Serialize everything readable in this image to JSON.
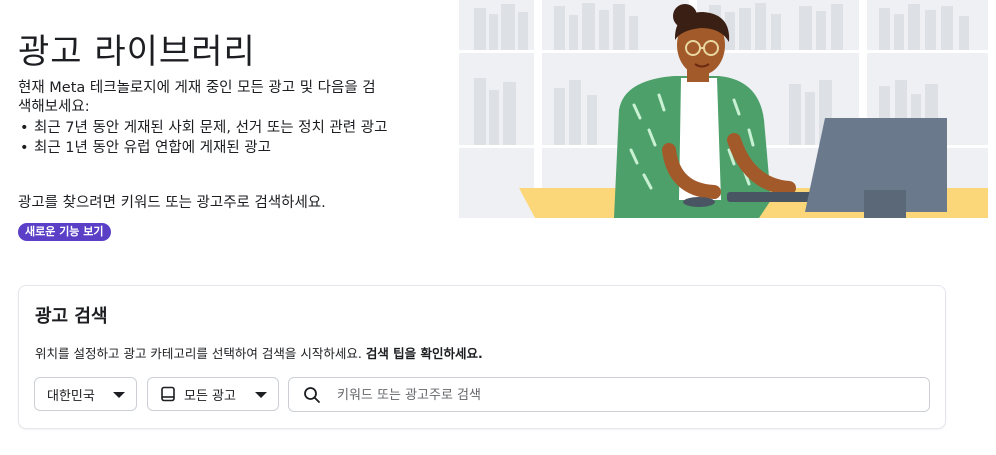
{
  "hero": {
    "title": "광고 라이브러리",
    "intro": "현재 Meta 테크놀로지에 게재 중인 모든 광고 및 다음을 검색해보세요:",
    "bullets": [
      "최근 7년 동안 게재된 사회 문제, 선거 또는 정치 관련 광고",
      "최근 1년 동안 유럽 연합에 게재된 광고"
    ],
    "hint": "광고를 찾으려면 키워드 또는 광고주로 검색하세요.",
    "new_badge": "새로운 기능 보기"
  },
  "search": {
    "title": "광고 검색",
    "description": "위치를 설정하고 광고 카테고리를 선택하여 검색을 시작하세요.",
    "tips_link": "검색 팁을 확인하세요.",
    "country_select": "대한민국",
    "ad_type_select": "모든 광고",
    "placeholder": "키워드 또는 광고주로 검색"
  },
  "colors": {
    "badge": "#5b3fc7",
    "card_border": "#e4e6eb",
    "desk": "#fbd77a",
    "monitor": "#6a7a8c",
    "sweater": "#4da06a"
  }
}
